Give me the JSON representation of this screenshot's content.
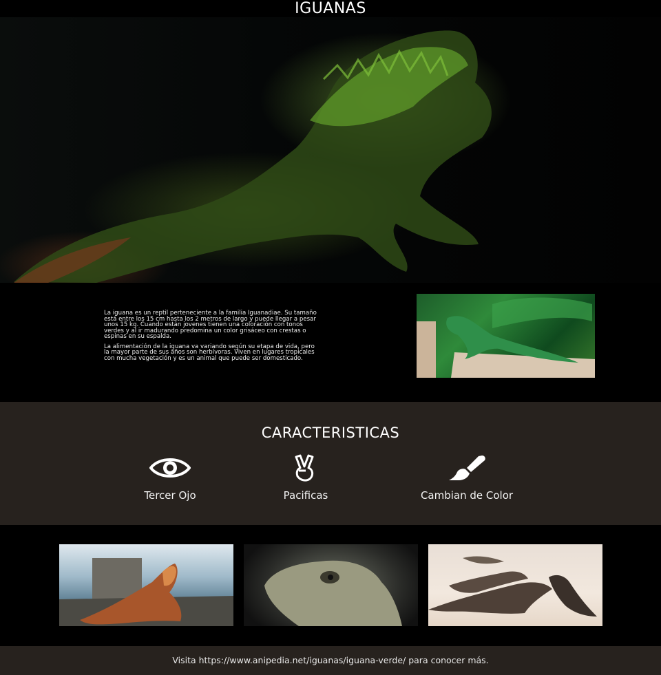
{
  "header": {
    "title": "IGUANAS"
  },
  "intro": {
    "paragraph_1": "La iguana es un reptil perteneciente a la familia Iguanadiae. Su tamaño está entre los 15 cm hasta los 2 metros de largo y puede llegar a pesar unos 15 kg. Cuando están jovenes tienen una coloración con tonos verdes y al ir madurando predomina un color grisáceo con crestas o espinas en su espalda.",
    "paragraph_2": "La alimentación de la iguana va variando según su etapa de vida, pero la mayor parte de sus años son herbívoras. Viven en lugares tropicales con mucha vegetación y es un animal que puede ser domesticado."
  },
  "features": {
    "title": "CARACTERISTICAS",
    "items": [
      {
        "label": "Tercer Ojo",
        "icon": "eye-icon"
      },
      {
        "label": "Pacificas",
        "icon": "peace-hand-icon"
      },
      {
        "label": "Cambian de Color",
        "icon": "paintbrush-icon"
      }
    ]
  },
  "footer": {
    "text": "Visita https://www.anipedia.net/iguanas/iguana-verde/ para conocer más."
  },
  "colors": {
    "band": "#27221e",
    "background": "#000000",
    "text": "#ffffff"
  }
}
